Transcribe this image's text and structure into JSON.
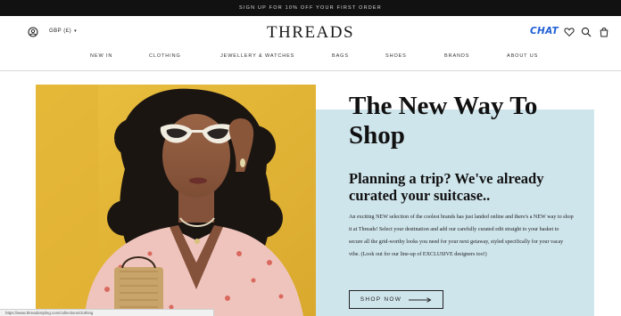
{
  "promo": {
    "text": "SIGN UP FOR 10% OFF YOUR FIRST ORDER"
  },
  "header": {
    "currency": "GBP (£)",
    "logo": "THREADS",
    "chat_label": "CHAT",
    "icons": [
      "user-icon",
      "heart-icon",
      "search-icon",
      "bag-icon"
    ],
    "accent_color": "#1f5fd6"
  },
  "nav": {
    "items": [
      {
        "label": "NEW IN"
      },
      {
        "label": "CLOTHING"
      },
      {
        "label": "JEWELLERY & WATCHES"
      },
      {
        "label": "BAGS"
      },
      {
        "label": "SHOES"
      },
      {
        "label": "BRANDS"
      },
      {
        "label": "ABOUT US"
      }
    ]
  },
  "hero": {
    "title": "The New Way To Shop",
    "subtitle": "Planning a trip? We've already curated your suitcase..",
    "body": "An exciting NEW selection of the coolest brands has just landed online and there's a NEW way to shop it at Threads! Select your destination and add our carefully curated edit straight to your basket to secure all the grid-worthy looks you need for your next getaway, styled specifically for your vacay vibe. (Look out for our line-up of EXCLUSIVE designers too!)",
    "cta_label": "SHOP NOW",
    "panel_color": "#cfe5ec",
    "photo_background": "#e8b93c"
  },
  "status_bar": {
    "url": "https://www.threadsstyling.com/collections/clothing"
  }
}
